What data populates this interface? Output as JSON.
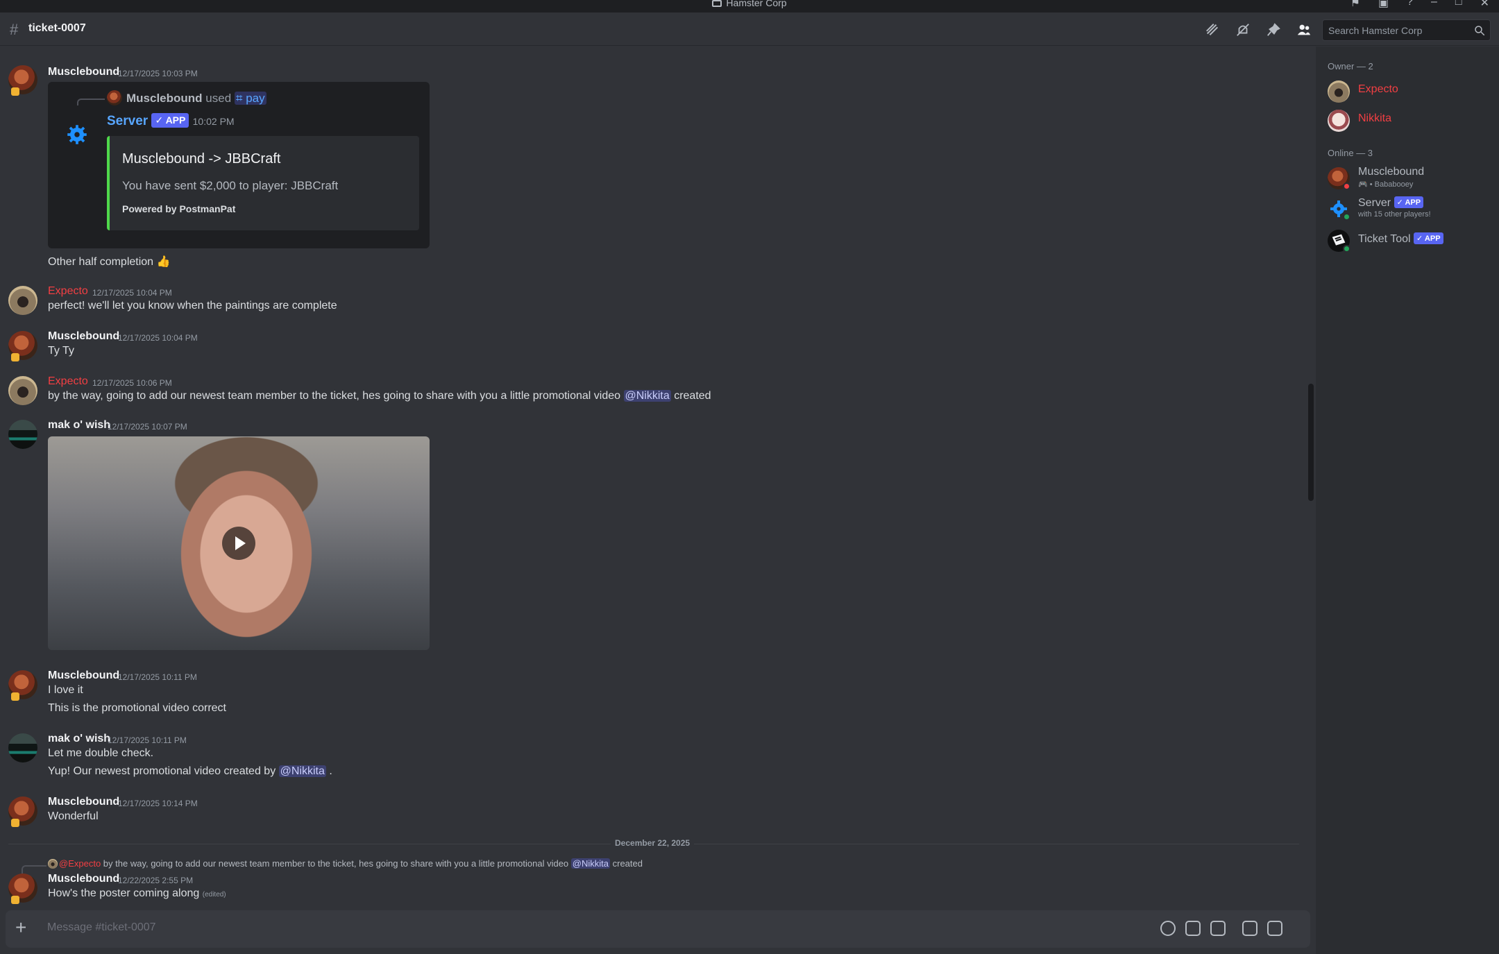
{
  "window": {
    "title": "Hamster Corp"
  },
  "header": {
    "channel_name": "ticket-0007",
    "search_placeholder": "Search Hamster Corp"
  },
  "messages": {
    "m1": {
      "author": "Musclebound",
      "time": "12/17/2025 10:03 PM",
      "reply": {
        "author": "Musclebound",
        "verb": "used",
        "command": "pay"
      },
      "bot": {
        "name": "Server",
        "badge": "APP",
        "time": "10:02 PM"
      },
      "embed": {
        "title": "Musclebound -> JBBCraft",
        "description": "You have sent $2,000 to player: JBBCraft",
        "footer": "Powered by PostmanPat",
        "accent": "#4fd84b"
      },
      "after": "Other half completion 👍"
    },
    "m2": {
      "author": "Expecto",
      "time": "12/17/2025 10:04 PM",
      "text": "perfect! we'll let you know when the paintings are complete"
    },
    "m3": {
      "author": "Musclebound",
      "time": "12/17/2025 10:04 PM",
      "text": "Ty Ty"
    },
    "m4": {
      "author": "Expecto",
      "time": "12/17/2025 10:06 PM",
      "text": "by the way, going to add our newest team member to the ticket, hes going to share with you a little promotional video",
      "mention": "@Nikkita",
      "text_end": "created"
    },
    "m5": {
      "author": "mak o' wish",
      "time": "12/17/2025 10:07 PM"
    },
    "m6": {
      "author": "Musclebound",
      "time": "12/17/2025 10:11 PM",
      "line1": "I love it",
      "line2": "This is the promotional video correct"
    },
    "m7": {
      "author": "mak o' wish",
      "time": "12/17/2025 10:11 PM",
      "line1": "Let me double check.",
      "line2_start": "Yup! Our newest promotional video created by",
      "mention": "@Nikkita",
      "line2_end": "."
    },
    "m8": {
      "author": "Musclebound",
      "time": "12/17/2025 10:14 PM",
      "text": "Wonderful"
    },
    "divider": "December 22, 2025",
    "m9": {
      "reply_mention": "@Expecto",
      "reply_text": "by the way, going to add our newest team member to the ticket, hes going to share with you a little promotional video",
      "reply_mention2": "@Nikkita",
      "reply_end": "created",
      "author": "Musclebound",
      "time": "12/22/2025 2:55 PM",
      "text": "How's the poster coming along",
      "edited": "(edited)"
    }
  },
  "composer": {
    "placeholder": "Message #ticket-0007"
  },
  "members": {
    "owner_header": "Owner — 2",
    "owners": [
      {
        "name": "Expecto"
      },
      {
        "name": "Nikkita"
      }
    ],
    "online_header": "Online — 3",
    "online": [
      {
        "name": "Musclebound",
        "status": "Bababooey"
      },
      {
        "name": "Server",
        "badge": "APP",
        "status": "with 15 other players!"
      },
      {
        "name": "Ticket Tool",
        "badge": "APP"
      }
    ]
  },
  "colors": {
    "accent": "#5865f2",
    "owner_red": "#f23f43",
    "server_blue": "#58a6ff",
    "background": "#313338"
  }
}
